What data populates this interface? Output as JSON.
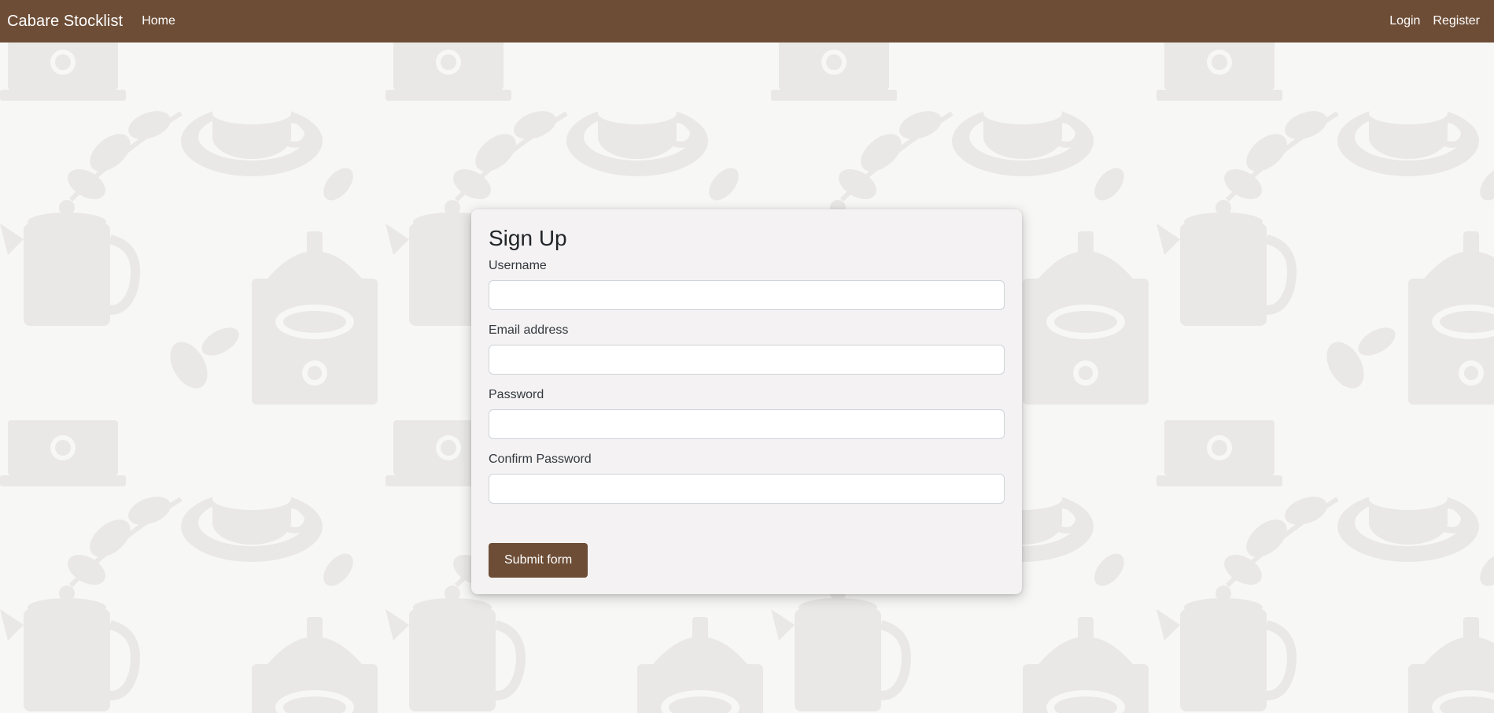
{
  "navbar": {
    "brand": "Cabare Stocklist",
    "home_label": "Home",
    "login_label": "Login",
    "register_label": "Register",
    "background_color": "#6d4d36"
  },
  "form": {
    "title": "Sign Up",
    "fields": [
      {
        "label": "Username",
        "value": "",
        "type": "text"
      },
      {
        "label": "Email address",
        "value": "",
        "type": "email"
      },
      {
        "label": "Password",
        "value": "",
        "type": "password"
      },
      {
        "label": "Confirm Password",
        "value": "",
        "type": "password"
      }
    ],
    "submit_label": "Submit form"
  },
  "theme": {
    "accent": "#6d4d36",
    "page_background": "#f7f7f6",
    "pattern_color": "#e8e7e5"
  },
  "background": {
    "pattern": "coffee-illustration-pattern",
    "icons": [
      "coffee-grinder-icon",
      "coffee-cup-icon",
      "coffee-pot-icon",
      "leaf-icon"
    ]
  }
}
